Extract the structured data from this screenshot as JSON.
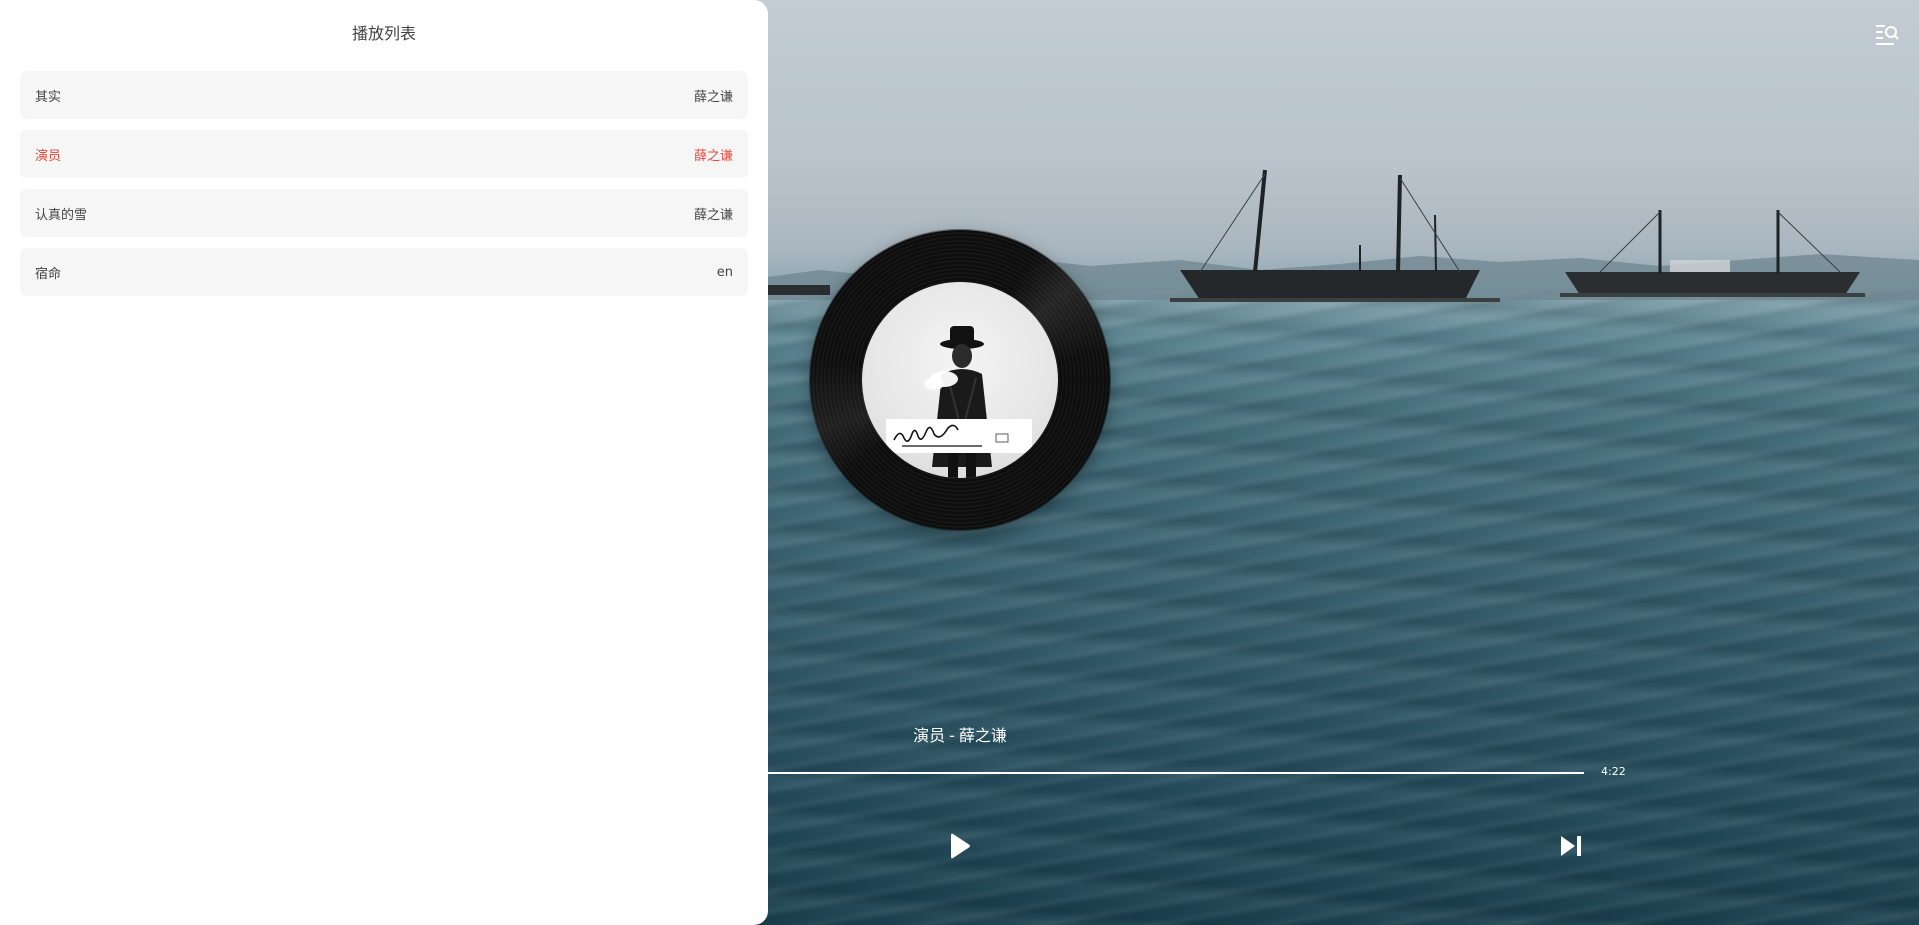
{
  "playlist": {
    "title": "播放列表",
    "tracks": [
      {
        "title": "其实",
        "artist": "薛之谦",
        "active": false
      },
      {
        "title": "演员",
        "artist": "薛之谦",
        "active": true
      },
      {
        "title": "认真的雪",
        "artist": "薛之谦",
        "active": false
      },
      {
        "title": "宿命",
        "artist": "en",
        "active": false
      }
    ]
  },
  "player": {
    "song": "演员",
    "separator": "-",
    "artist": "薛之谦",
    "duration": "4:22",
    "progress": 1.0
  },
  "colors": {
    "accent": "#e8483a",
    "panel_bg": "#ffffff",
    "item_bg": "#f6f6f6"
  },
  "icons": {
    "play": "play-icon",
    "next": "skip-next-icon",
    "playlist_toggle": "playlist-search-icon"
  }
}
